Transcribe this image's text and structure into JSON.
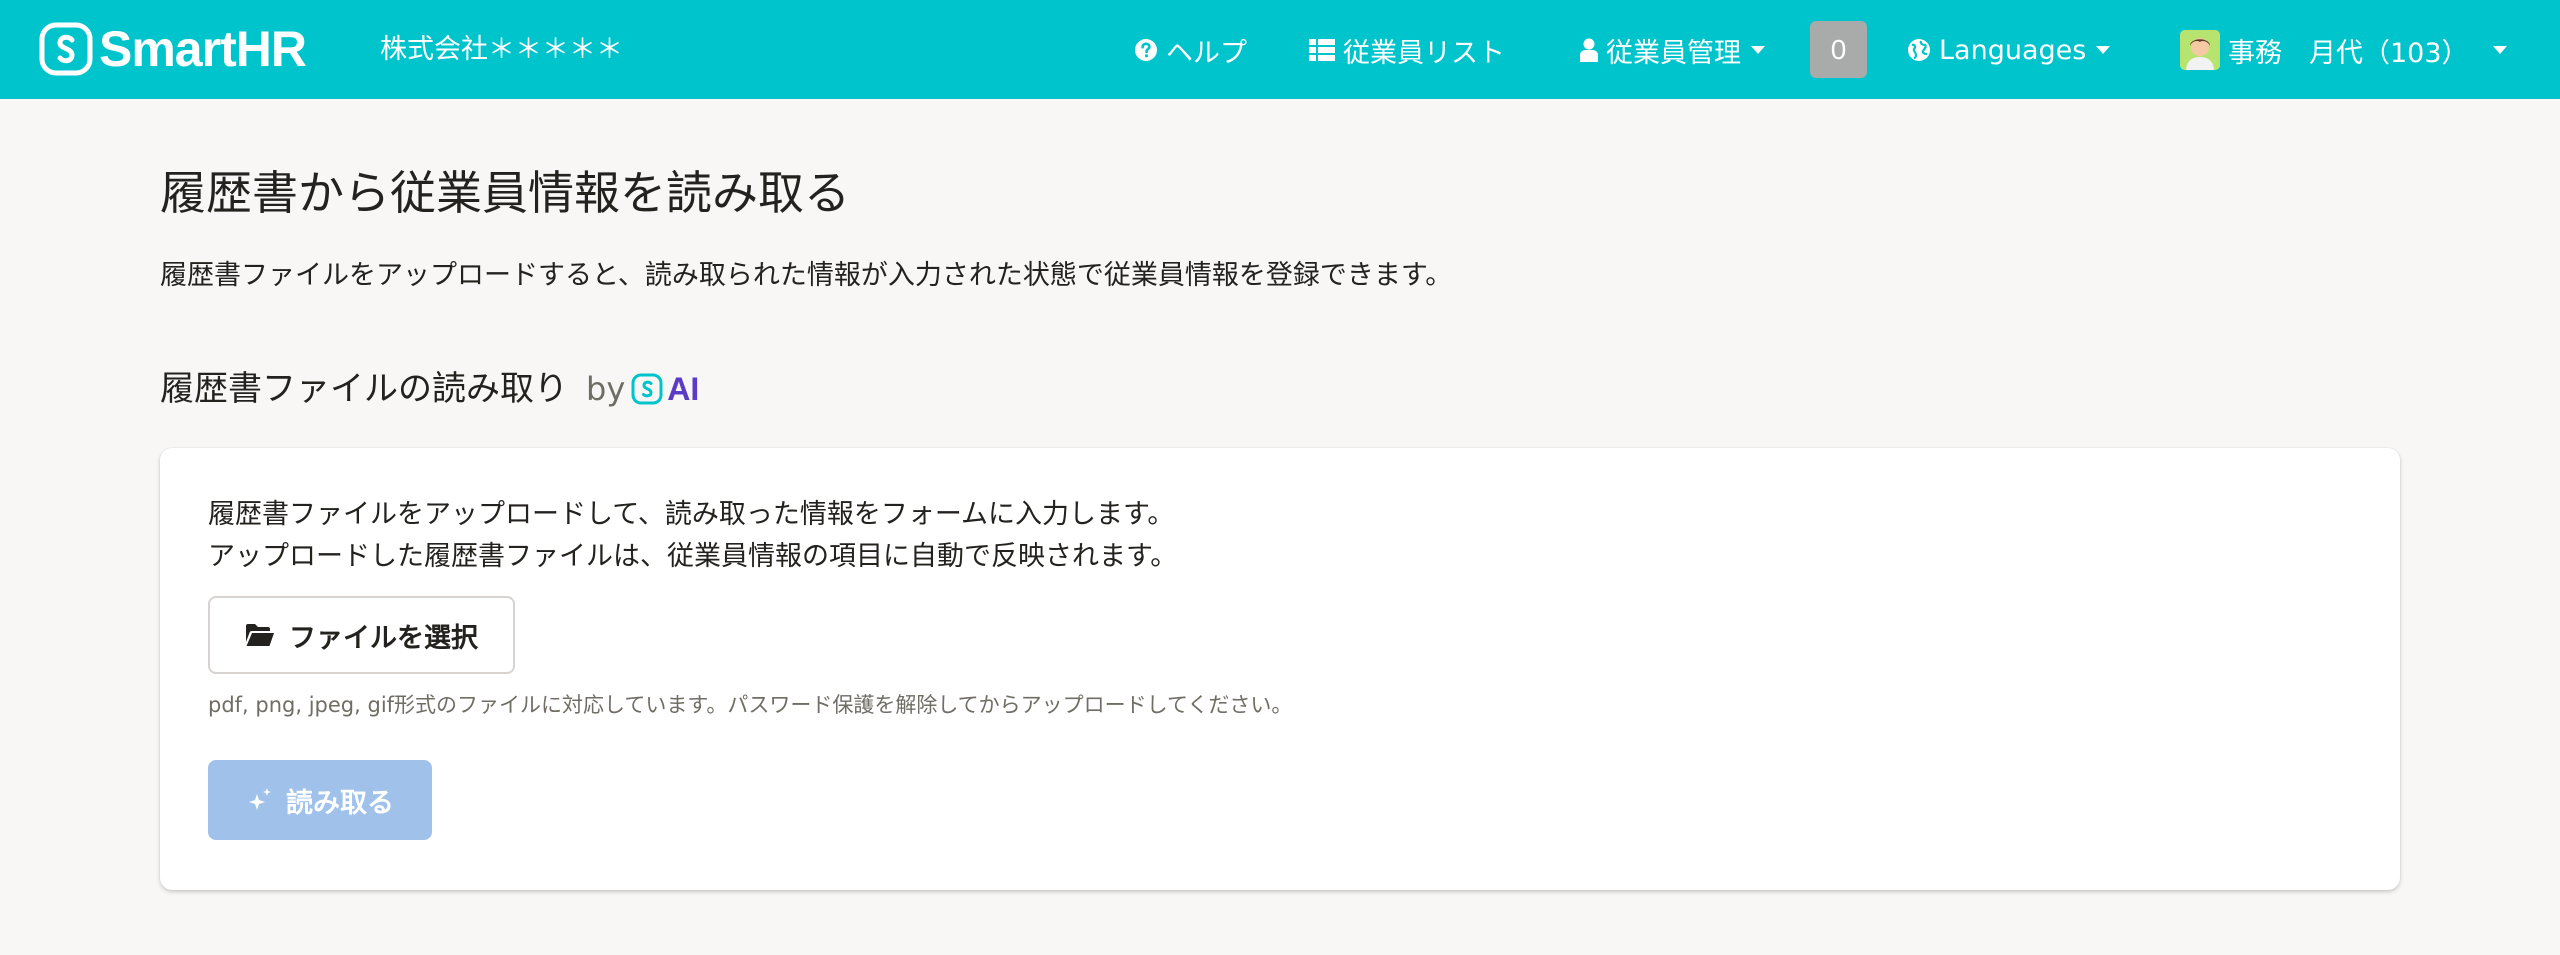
{
  "header": {
    "brand": "SmartHR",
    "company": "株式会社＊＊＊＊＊",
    "nav": {
      "help": "ヘルプ",
      "employee_list": "従業員リスト",
      "employee_manage": "従業員管理",
      "notification_count": "0",
      "languages": "Languages",
      "user": "事務　月代（103）"
    },
    "icons": {
      "help": "question-circle-icon",
      "list": "list-icon",
      "manage": "user-icon",
      "languages": "globe-icon"
    },
    "colors": {
      "header_bg": "#00c4cc",
      "badge_bg": "#a9aaaa"
    }
  },
  "main": {
    "title": "履歴書から従業員情報を読み取る",
    "description": "履歴書ファイルをアップロードすると、読み取られた情報が入力された状態で従業員情報を登録できます。",
    "section": {
      "title": "履歴書ファイルの読み取り",
      "by": "by",
      "ai_label": "AI"
    },
    "card": {
      "line1": "履歴書ファイルをアップロードして、読み取った情報をフォームに入力します。",
      "line2": "アップロードした履歴書ファイルは、従業員情報の項目に自動で反映されます。",
      "file_button": "ファイルを選択",
      "hint": "pdf, png, jpeg, gif形式のファイルに対応しています。パスワード保護を解除してからアップロードしてください。",
      "read_button": "読み取る",
      "read_button_disabled": true
    },
    "colors": {
      "page_bg": "#f8f7f6",
      "disabled_button_bg": "#9fc1ea"
    }
  }
}
